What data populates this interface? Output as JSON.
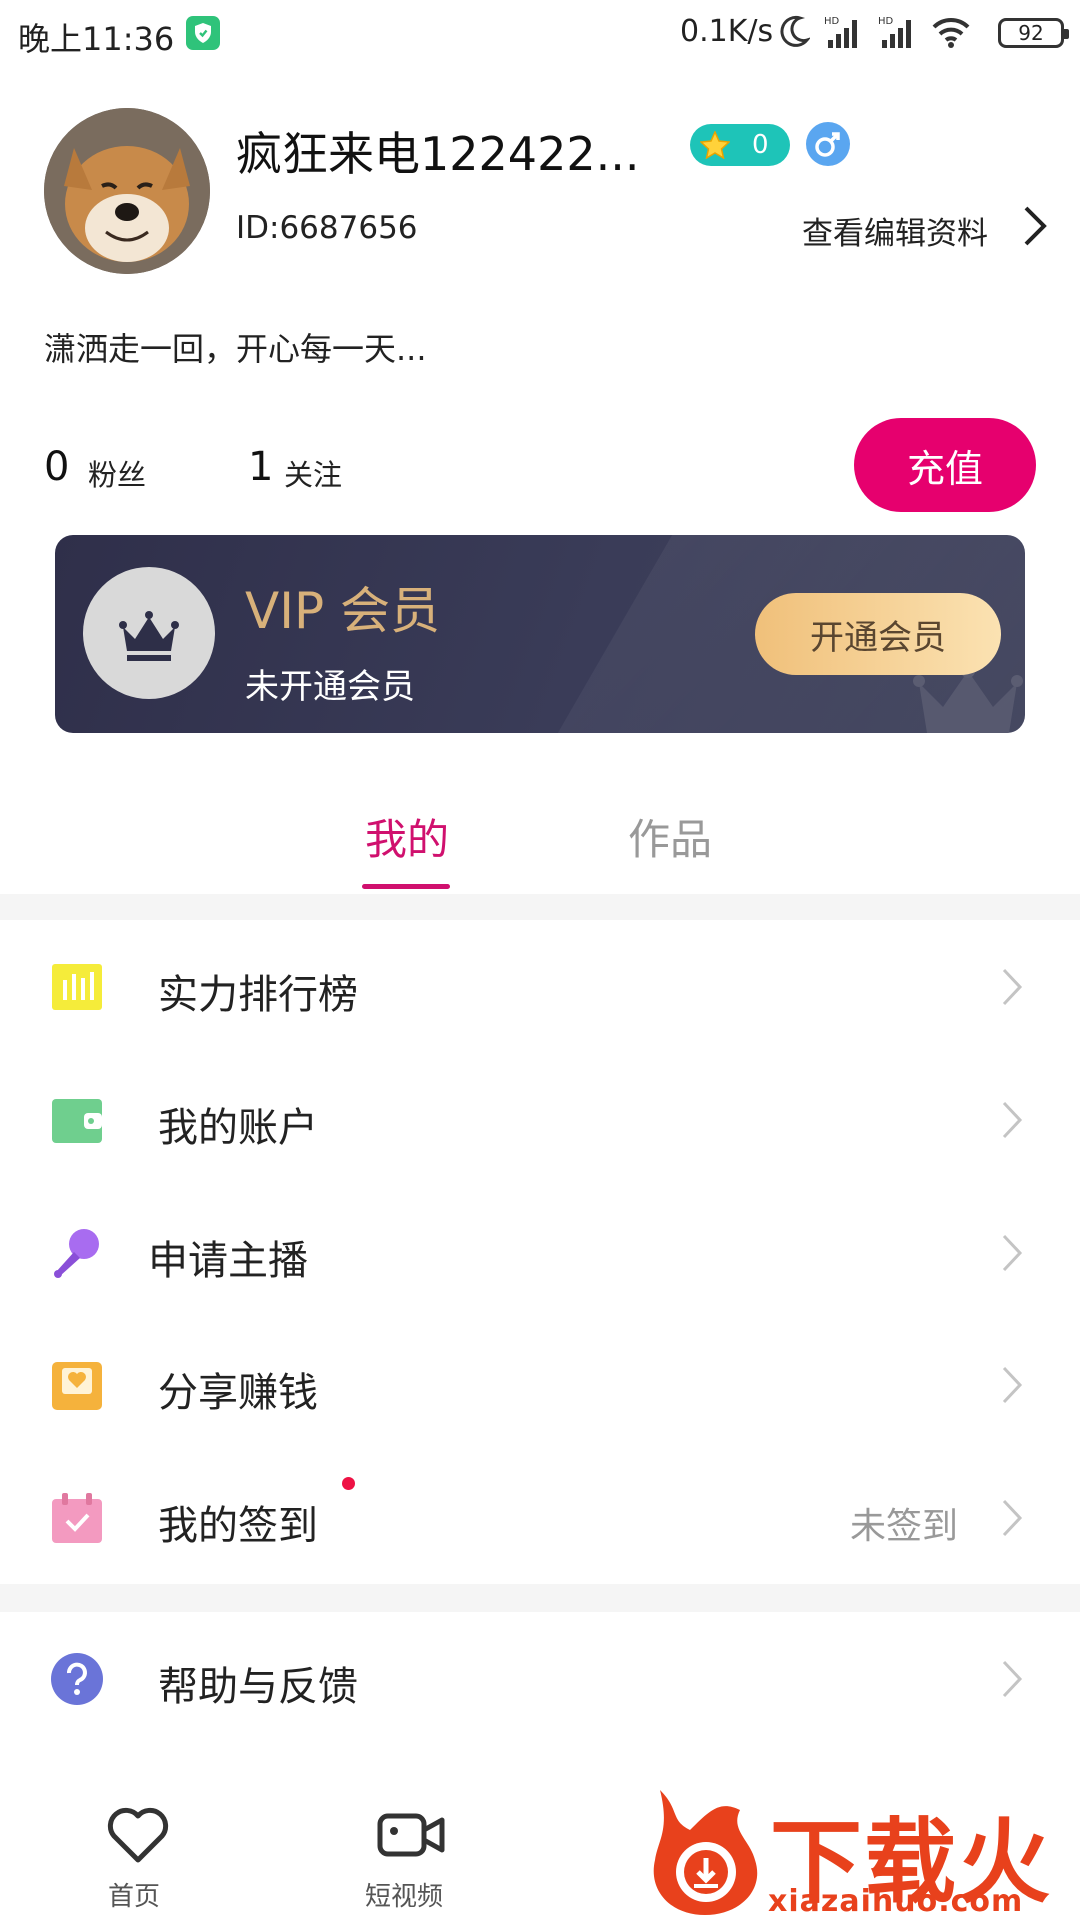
{
  "status_bar": {
    "time": "晚上11:36",
    "speed": "0.1K/s",
    "battery": "92"
  },
  "profile": {
    "username": "疯狂来电122422...",
    "level_value": "0",
    "user_id": "ID:6687656",
    "edit_label": "查看编辑资料",
    "signature": "潇洒走一回，开心每一天...",
    "fans_count": "0",
    "fans_label": "粉丝",
    "follow_count": "1",
    "follow_label": "关注",
    "recharge_label": "充值"
  },
  "vip": {
    "title": "VIP 会员",
    "status": "未开通会员",
    "open_label": "开通会员"
  },
  "tabs": {
    "mine": "我的",
    "works": "作品"
  },
  "menu": {
    "ranking": "实力排行榜",
    "account": "我的账户",
    "apply_anchor": "申请主播",
    "share_earn": "分享赚钱",
    "checkin": "我的签到",
    "checkin_status": "未签到",
    "help": "帮助与反馈"
  },
  "bottom_nav": {
    "home": "首页",
    "short_video": "短视频"
  },
  "watermark": {
    "title": "下载火",
    "url": "xiazaihuo.com"
  },
  "colors": {
    "accent": "#d0106e",
    "recharge": "#e6006e",
    "vip_gold": "#d8b17a"
  }
}
